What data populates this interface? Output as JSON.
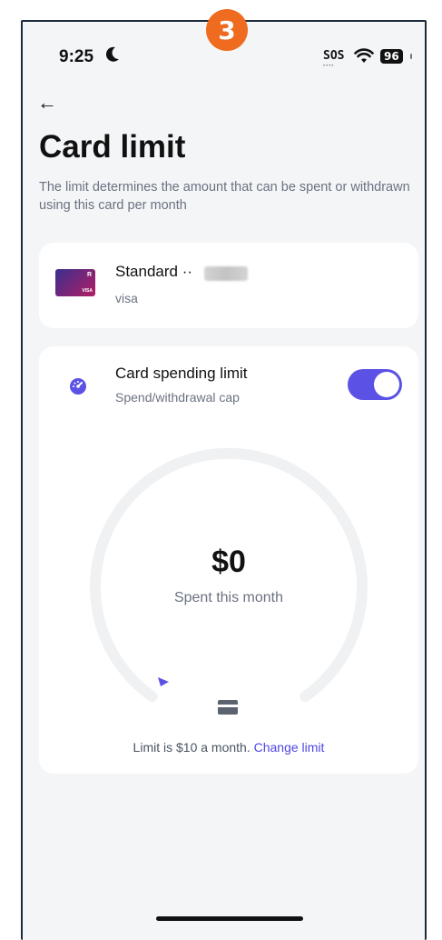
{
  "step_badge": "3",
  "status_bar": {
    "time": "9:25",
    "sos": "SOS",
    "battery": "96",
    "icons": [
      "moon-icon",
      "wifi-icon",
      "battery-icon"
    ]
  },
  "header": {
    "back_icon": "arrow-left-icon",
    "title": "Card limit",
    "subtitle": "The limit determines the amount that can be spent or withdrawn using this card per month"
  },
  "card": {
    "name": "Standard ··",
    "type": "visa",
    "thumb_r": "R",
    "thumb_visa": "VISA"
  },
  "limit": {
    "title": "Card spending limit",
    "subtitle": "Spend/withdrawal cap",
    "toggle_on": true,
    "amount": "$0",
    "amount_caption": "Spent this month",
    "spent_fraction": 0,
    "footer_text": "Limit is $10 a month.",
    "change_link": "Change limit"
  },
  "colors": {
    "accent": "#5b52e5",
    "badge": "#ee6b1f",
    "gauge_track": "#f0f1f3"
  }
}
